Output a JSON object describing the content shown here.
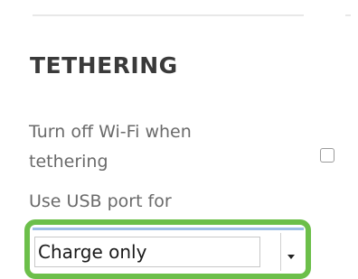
{
  "section": {
    "title": "TETHERING"
  },
  "wifi_option": {
    "label": "Turn off Wi-Fi when tethering",
    "checked": false
  },
  "usb_option": {
    "label": "Use USB port for",
    "selected_value": "Charge only"
  },
  "colors": {
    "highlight": "#6cbf4a",
    "title_text": "#3a3a3a",
    "label_text": "#6a6a6a",
    "select_focus_line": "#9ebfe6"
  },
  "icons": {
    "dropdown": "chevron-down-icon"
  }
}
